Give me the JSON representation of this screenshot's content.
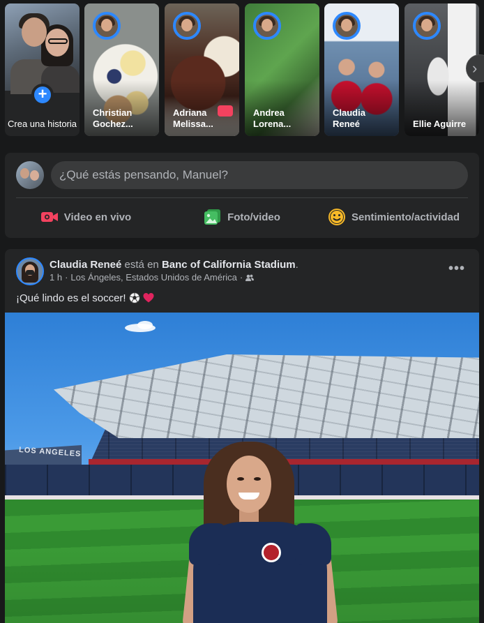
{
  "stories": {
    "create": {
      "label": "Crea una historia",
      "plus": "+"
    },
    "items": [
      {
        "name": "Christian Gochez..."
      },
      {
        "name": "Adriana Melissa..."
      },
      {
        "name": "Andrea Lorena..."
      },
      {
        "name": "Claudia Reneé"
      },
      {
        "name": "Ellie Aguirre"
      }
    ],
    "next_icon": "chevron-right-icon",
    "next_glyph": "›"
  },
  "composer": {
    "placeholder": "¿Qué estás pensando, Manuel?",
    "actions": {
      "live": "Video en vivo",
      "photo": "Foto/video",
      "feeling": "Sentimiento/actividad"
    }
  },
  "post": {
    "author": "Claudia Reneé",
    "connector": "está en",
    "place": "Banc of California Stadium",
    "period": ".",
    "time": "1 h",
    "dot": "·",
    "location": "Los Ángeles, Estados Unidos de América",
    "text": "¡Qué lindo es el soccer!",
    "more": "•••"
  },
  "colors": {
    "background": "#18191a",
    "card": "#242526",
    "accent": "#2d88ff",
    "live_red": "#f3425f",
    "photo_green": "#45bd62",
    "feeling_yellow": "#f7b928"
  }
}
